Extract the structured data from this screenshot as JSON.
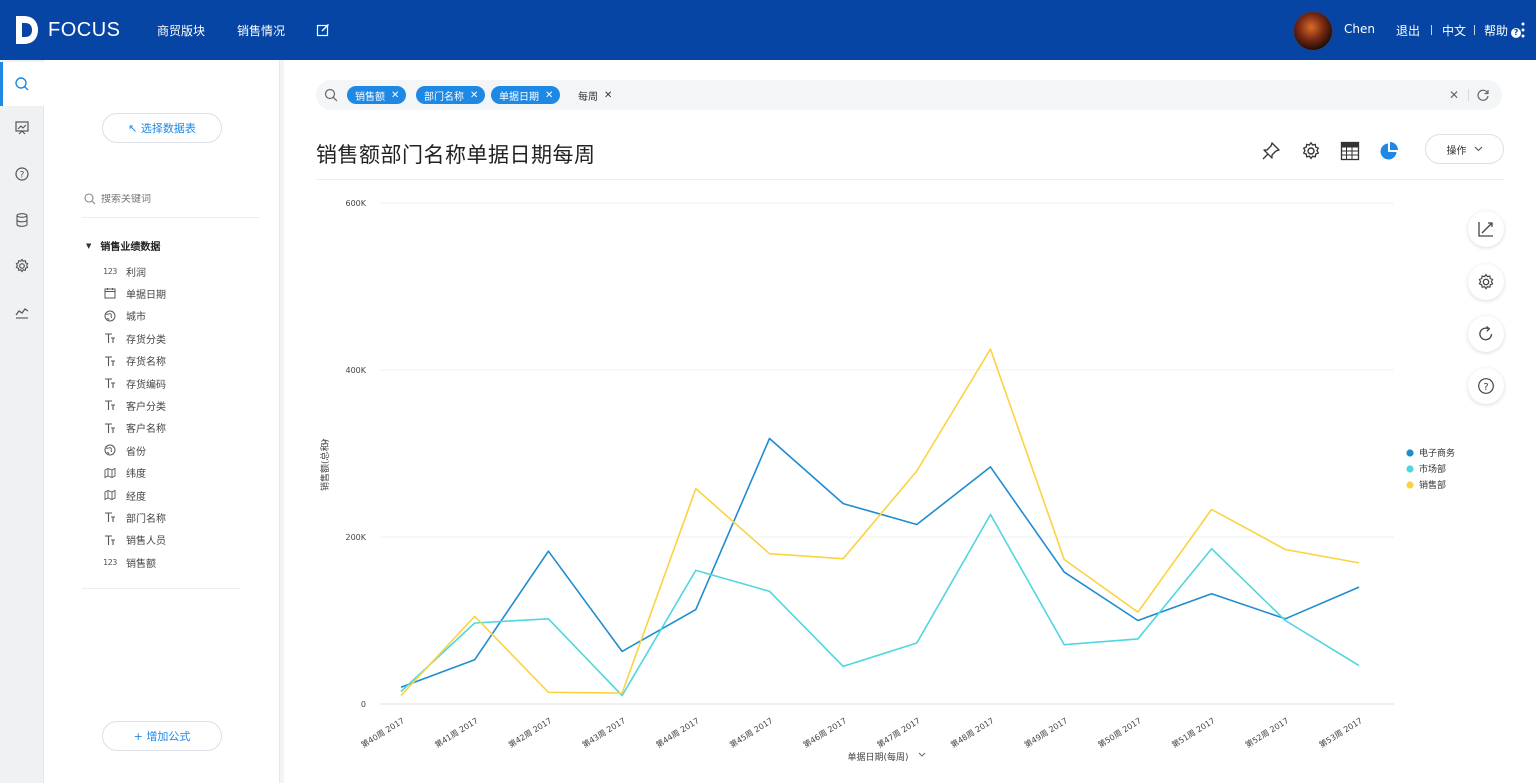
{
  "app": {
    "logo_text": "FOCUS",
    "nav": [
      "商贸版块",
      "销售情况"
    ],
    "user_name": "Chen",
    "logout": "退出",
    "language": "中文",
    "help": "帮助",
    "brand_color": "#0645a4",
    "accent_color": "#1e88e5"
  },
  "rail": {
    "items": [
      "search-icon",
      "board-icon",
      "help-icon",
      "database-icon",
      "settings-icon",
      "chart-icon"
    ]
  },
  "panel": {
    "select_table": "↖ 选择数据表",
    "search_placeholder": "搜索关键词",
    "root": "销售业绩数据",
    "fields": [
      {
        "label": "利润",
        "icon": "number-icon"
      },
      {
        "label": "单据日期",
        "icon": "calendar-icon"
      },
      {
        "label": "城市",
        "icon": "globe-icon"
      },
      {
        "label": "存货分类",
        "icon": "text-icon"
      },
      {
        "label": "存货名称",
        "icon": "text-icon"
      },
      {
        "label": "存货编码",
        "icon": "text-icon"
      },
      {
        "label": "客户分类",
        "icon": "text-icon"
      },
      {
        "label": "客户名称",
        "icon": "text-icon"
      },
      {
        "label": "省份",
        "icon": "globe-icon"
      },
      {
        "label": "纬度",
        "icon": "map-icon"
      },
      {
        "label": "经度",
        "icon": "map-icon"
      },
      {
        "label": "部门名称",
        "icon": "text-icon"
      },
      {
        "label": "销售人员",
        "icon": "text-icon"
      },
      {
        "label": "销售额",
        "icon": "number-icon"
      }
    ],
    "add_formula": "+ 增加公式"
  },
  "search": {
    "tokens": [
      "销售额",
      "部门名称",
      "单据日期"
    ],
    "plain_token": "每周"
  },
  "page_title": "销售额部门名称单据日期每周",
  "ops_label": "操作",
  "chart_data": {
    "type": "line",
    "title": "",
    "xlabel": "单据日期(每周)",
    "ylabel": "销售额(总和)",
    "ylim": [
      0,
      600000
    ],
    "yticks": [
      "0",
      "200K",
      "400K",
      "600K"
    ],
    "ytick_values": [
      0,
      200000,
      400000,
      600000
    ],
    "grid": true,
    "legend_position": "right",
    "categories": [
      "第40周 2017",
      "第41周 2017",
      "第42周 2017",
      "第43周 2017",
      "第44周 2017",
      "第45周 2017",
      "第46周 2017",
      "第47周 2017",
      "第48周 2017",
      "第49周 2017",
      "第50周 2017",
      "第51周 2017",
      "第52周 2017",
      "第53周 2017"
    ],
    "series": [
      {
        "name": "电子商务",
        "color": "#1f8cd0",
        "values": [
          20000,
          53000,
          183000,
          63000,
          113000,
          318000,
          240000,
          215000,
          284000,
          158000,
          100000,
          132000,
          102000,
          140000
        ]
      },
      {
        "name": "市场部",
        "color": "#4fd6e0",
        "values": [
          15000,
          97000,
          102000,
          10000,
          160000,
          135000,
          45000,
          73000,
          227000,
          71000,
          78000,
          186000,
          100000,
          46000
        ]
      },
      {
        "name": "销售部",
        "color": "#fbd341",
        "values": [
          10000,
          105000,
          14000,
          13000,
          258000,
          180000,
          174000,
          279000,
          425000,
          173000,
          110000,
          233000,
          185000,
          169000
        ]
      }
    ]
  }
}
